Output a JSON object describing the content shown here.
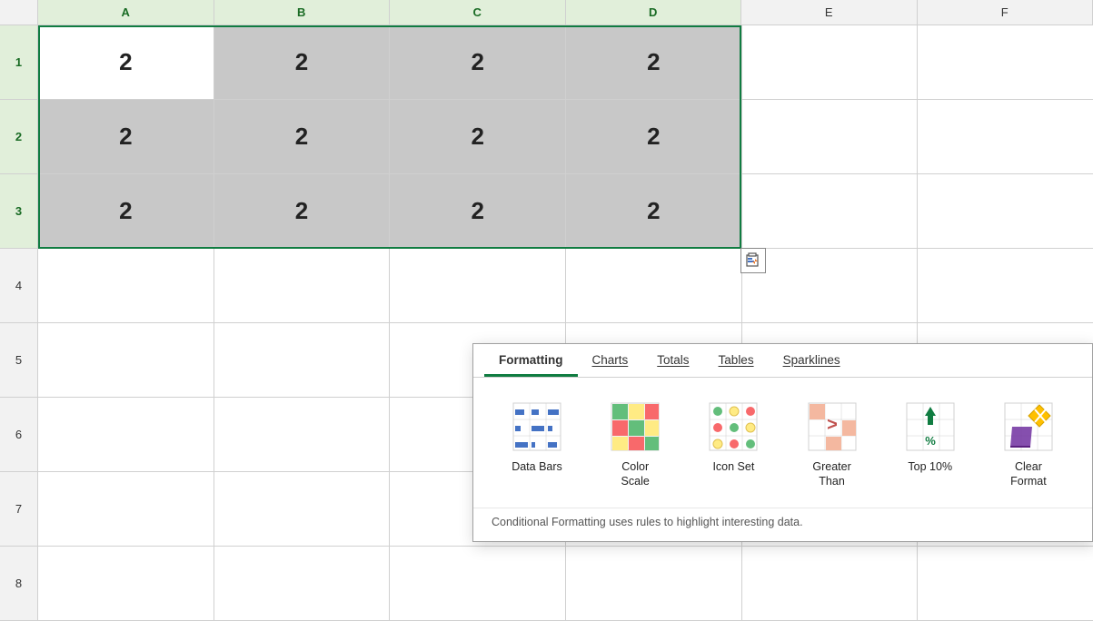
{
  "spreadsheet": {
    "col_headers": [
      "",
      "A",
      "B",
      "C",
      "D",
      "E",
      "F"
    ],
    "row_headers": [
      "1",
      "2",
      "3",
      "4",
      "5",
      "6",
      "7",
      "8"
    ],
    "cell_value": "2",
    "selected_range": "A1:D3"
  },
  "quick_analysis": {
    "tooltip": "Quick Analysis"
  },
  "popup": {
    "tabs": [
      {
        "id": "formatting",
        "label": "Formatting",
        "active": true
      },
      {
        "id": "charts",
        "label": "Charts",
        "active": false
      },
      {
        "id": "totals",
        "label": "Totals",
        "active": false
      },
      {
        "id": "tables",
        "label": "Tables",
        "active": false
      },
      {
        "id": "sparklines",
        "label": "Sparklines",
        "active": false
      }
    ],
    "formatting_items": [
      {
        "id": "data-bars",
        "label": "Data Bars"
      },
      {
        "id": "color-scale",
        "label": "Color Scale"
      },
      {
        "id": "icon-set",
        "label": "Icon Set"
      },
      {
        "id": "greater-than",
        "label": "Greater Than"
      },
      {
        "id": "top-10",
        "label": "Top 10%"
      },
      {
        "id": "clear-format",
        "label": "Clear Format"
      }
    ],
    "description": "Conditional Formatting uses rules to highlight interesting data."
  }
}
